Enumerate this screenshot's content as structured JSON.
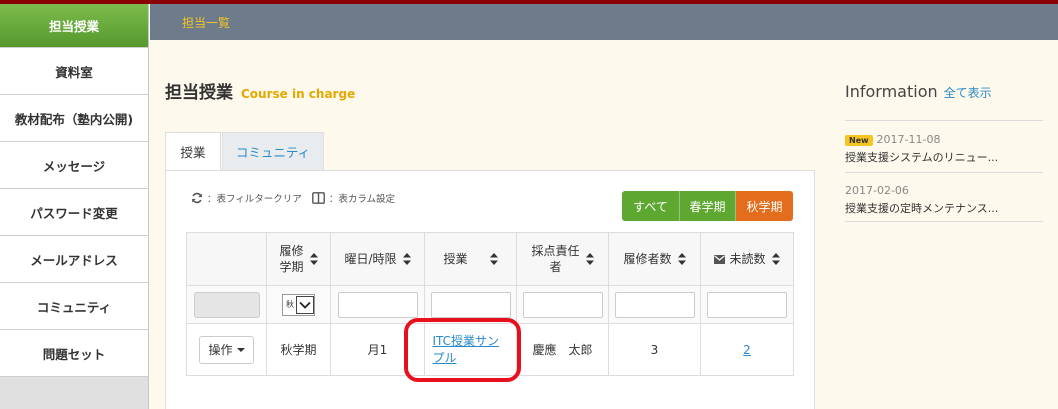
{
  "sidebar": {
    "items": [
      {
        "label": "担当授業",
        "active": true
      },
      {
        "label": "資料室"
      },
      {
        "label": "教材配布（塾内公開)"
      },
      {
        "label": "メッセージ"
      },
      {
        "label": "パスワード変更"
      },
      {
        "label": "メールアドレス"
      },
      {
        "label": "コミュニティ"
      },
      {
        "label": "問題セット"
      }
    ]
  },
  "topbar": {
    "breadcrumb": "担当一覧"
  },
  "page": {
    "title": "担当授業",
    "subtitle": "Course in charge"
  },
  "tabs": [
    {
      "label": "授業",
      "active": true
    },
    {
      "label": "コミュニティ"
    }
  ],
  "tools": {
    "clear_filter": "：表フィルタークリア",
    "column_setting": "：表カラム設定"
  },
  "filters": {
    "all": "すべて",
    "spring": "春学期",
    "autumn": "秋学期"
  },
  "table": {
    "headers": {
      "term_line1": "履修",
      "term_line2": "学期",
      "day_period": "曜日/時限",
      "course": "授業",
      "grader_line1": "採点責任",
      "grader_line2": "者",
      "enrolled": "履修者数",
      "unread": "未読数"
    },
    "filter_select_value": "秋",
    "row": {
      "op_label": "操作",
      "term": "秋学期",
      "day_period": "月1",
      "course_line1": "ITC授業サン",
      "course_line2": "プル",
      "grader": "慶應　太郎",
      "enrolled": "3",
      "unread": "2"
    }
  },
  "info": {
    "title": "Information",
    "show_all": "全て表示",
    "items": [
      {
        "badge": "New",
        "date": "2017-11-08",
        "title": "授業支援システムのリニュー..."
      },
      {
        "date": "2017-02-06",
        "title": "授業支援の定時メンテナンス..."
      }
    ]
  },
  "colors": {
    "sidebar_active": "#5ea832",
    "topbar": "#6d7b8b",
    "breadcrumb": "#f5c623",
    "autumn_button": "#e36d1c",
    "link": "#2a8ac8",
    "highlight": "#e8101e"
  }
}
